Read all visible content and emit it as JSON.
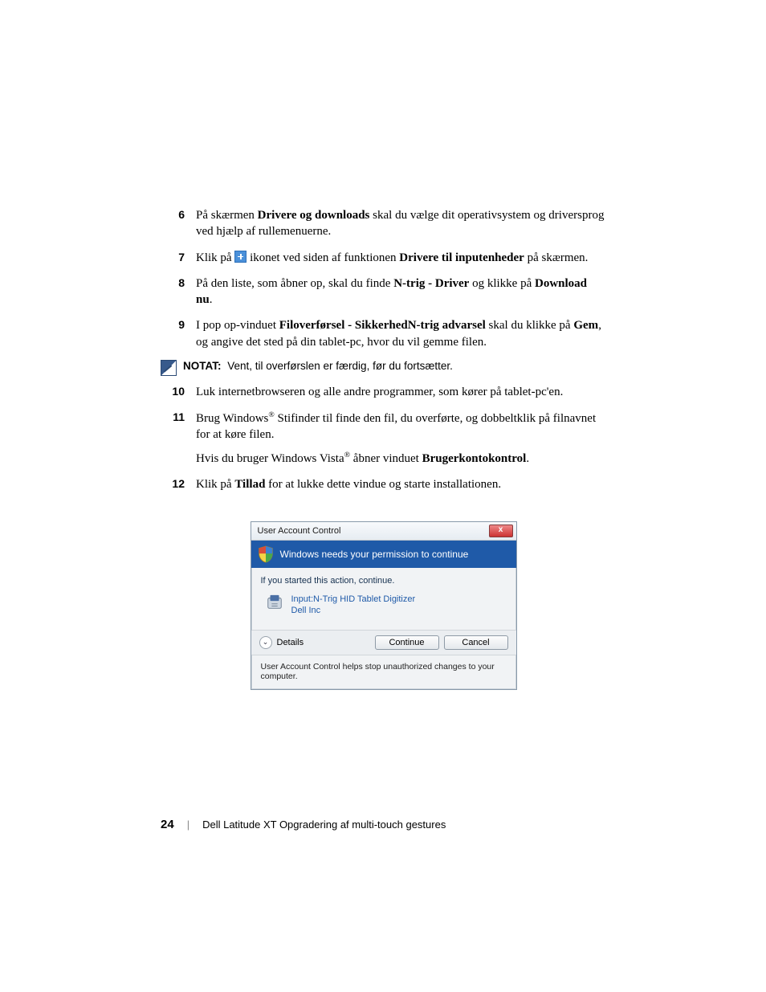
{
  "steps": {
    "6": {
      "num": "6",
      "pre": "På skærmen ",
      "bold1": "Drivere og downloads",
      "post": " skal du vælge dit operativsystem og driversprog ved hjælp af rullemenuerne."
    },
    "7": {
      "num": "7",
      "pre": "Klik på ",
      "mid": " ikonet ved siden af funktionen ",
      "bold1": "Drivere til inputenheder",
      "post": " på skærmen."
    },
    "8": {
      "num": "8",
      "pre": "På den liste, som åbner op, skal du finde ",
      "bold1": "N-trig - Driver",
      "mid": " og klikke på ",
      "bold2": "Download nu",
      "post": "."
    },
    "9": {
      "num": "9",
      "pre": "I pop op-vinduet ",
      "bold1": "Filoverførsel - Sikkerhed",
      "bold1b": "N-trig advarsel",
      "mid": " skal du klikke på ",
      "bold2": "Gem",
      "post": ", og angive det sted på din tablet-pc, hvor du vil gemme filen."
    },
    "10": {
      "num": "10",
      "text": "Luk internetbrowseren og alle andre programmer, som kører på tablet-pc'en."
    },
    "11": {
      "num": "11",
      "pre": "Brug Windows",
      "reg1": "®",
      "mid": " Stifinder til finde den fil, du overførte, og dobbeltklik på filnavnet for at køre filen.",
      "extra_pre": "Hvis du bruger Windows Vista",
      "reg2": "®",
      "extra_mid": " åbner vinduet ",
      "extra_bold": "Brugerkontokontrol",
      "extra_post": "."
    },
    "12": {
      "num": "12",
      "pre": "Klik på ",
      "bold1": "Tillad",
      "post": " for at lukke dette vindue og starte installationen."
    }
  },
  "note": {
    "label": "NOTAT:",
    "text": " Vent, til overførslen er færdig, før du fortsætter."
  },
  "uac": {
    "title": "User Account Control",
    "close": "x",
    "banner": "Windows needs your permission to continue",
    "subline": "If you started this action, continue.",
    "app_line1": "Input:N-Trig HID Tablet Digitizer",
    "app_line2": "Dell Inc",
    "details": "Details",
    "continue": "Continue",
    "cancel": "Cancel",
    "footer": "User Account Control helps stop unauthorized changes to your computer."
  },
  "footer": {
    "page": "24",
    "text": "Dell Latitude XT Opgradering af multi-touch gestures"
  }
}
